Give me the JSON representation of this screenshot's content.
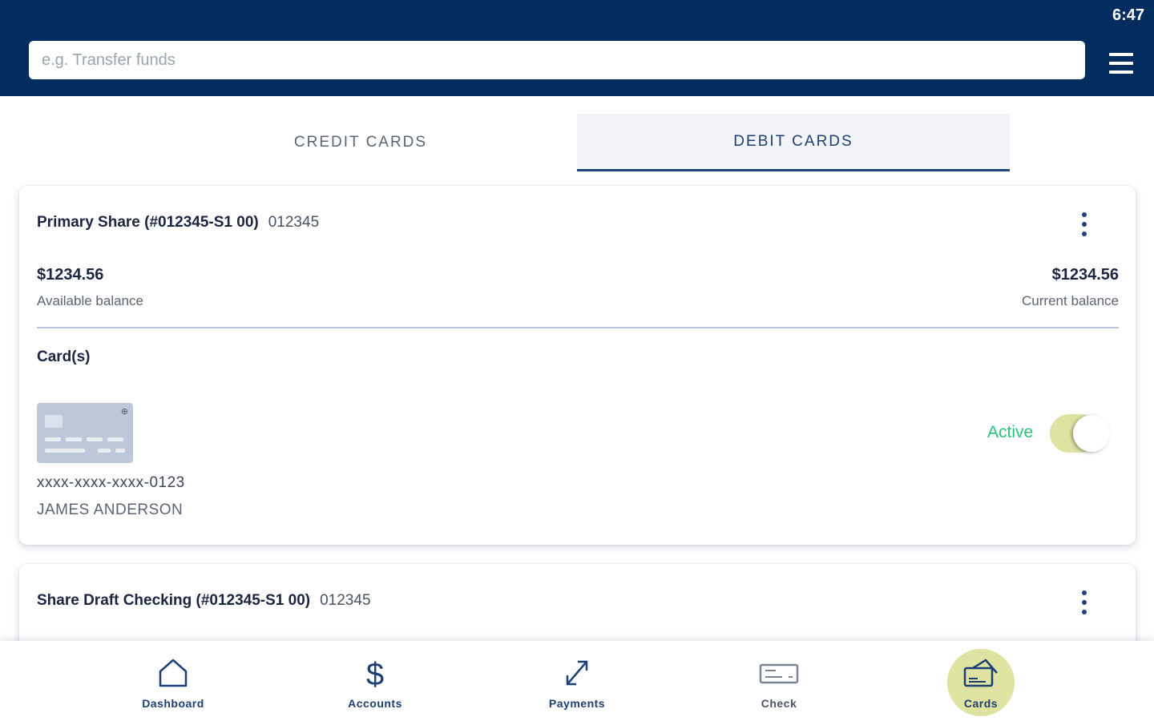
{
  "status_bar": {
    "time": "6:47"
  },
  "search": {
    "placeholder": "e.g. Transfer funds"
  },
  "tabs": [
    {
      "label": "CREDIT CARDS",
      "selected": false
    },
    {
      "label": "DEBIT CARDS",
      "selected": true
    }
  ],
  "accounts": [
    {
      "title": "Primary Share (#012345-S1 00)",
      "number": "012345",
      "available_amount": "$1234.56",
      "available_label": "Available balance",
      "current_amount": "$1234.56",
      "current_label": "Current balance",
      "cards_label": "Card(s)",
      "card": {
        "masked_number": "xxxx-xxxx-xxxx-0123",
        "holder": "JAMES ANDERSON",
        "status": "Active",
        "enabled": true
      }
    },
    {
      "title": "Share Draft Checking (#012345-S1 00)",
      "number": "012345"
    }
  ],
  "bottom_nav": [
    {
      "label": "Dashboard",
      "icon": "home-icon"
    },
    {
      "label": "Accounts",
      "icon": "dollar-icon"
    },
    {
      "label": "Payments",
      "icon": "arrows-diagonal-icon"
    },
    {
      "label": "Check",
      "icon": "check-icon"
    },
    {
      "label": "Cards",
      "icon": "credit-card-icon",
      "selected": true
    }
  ],
  "colors": {
    "header": "#032d5e",
    "accent": "#1d3f73",
    "active_green": "#2bc27b",
    "highlight": "#dfe3a2"
  }
}
